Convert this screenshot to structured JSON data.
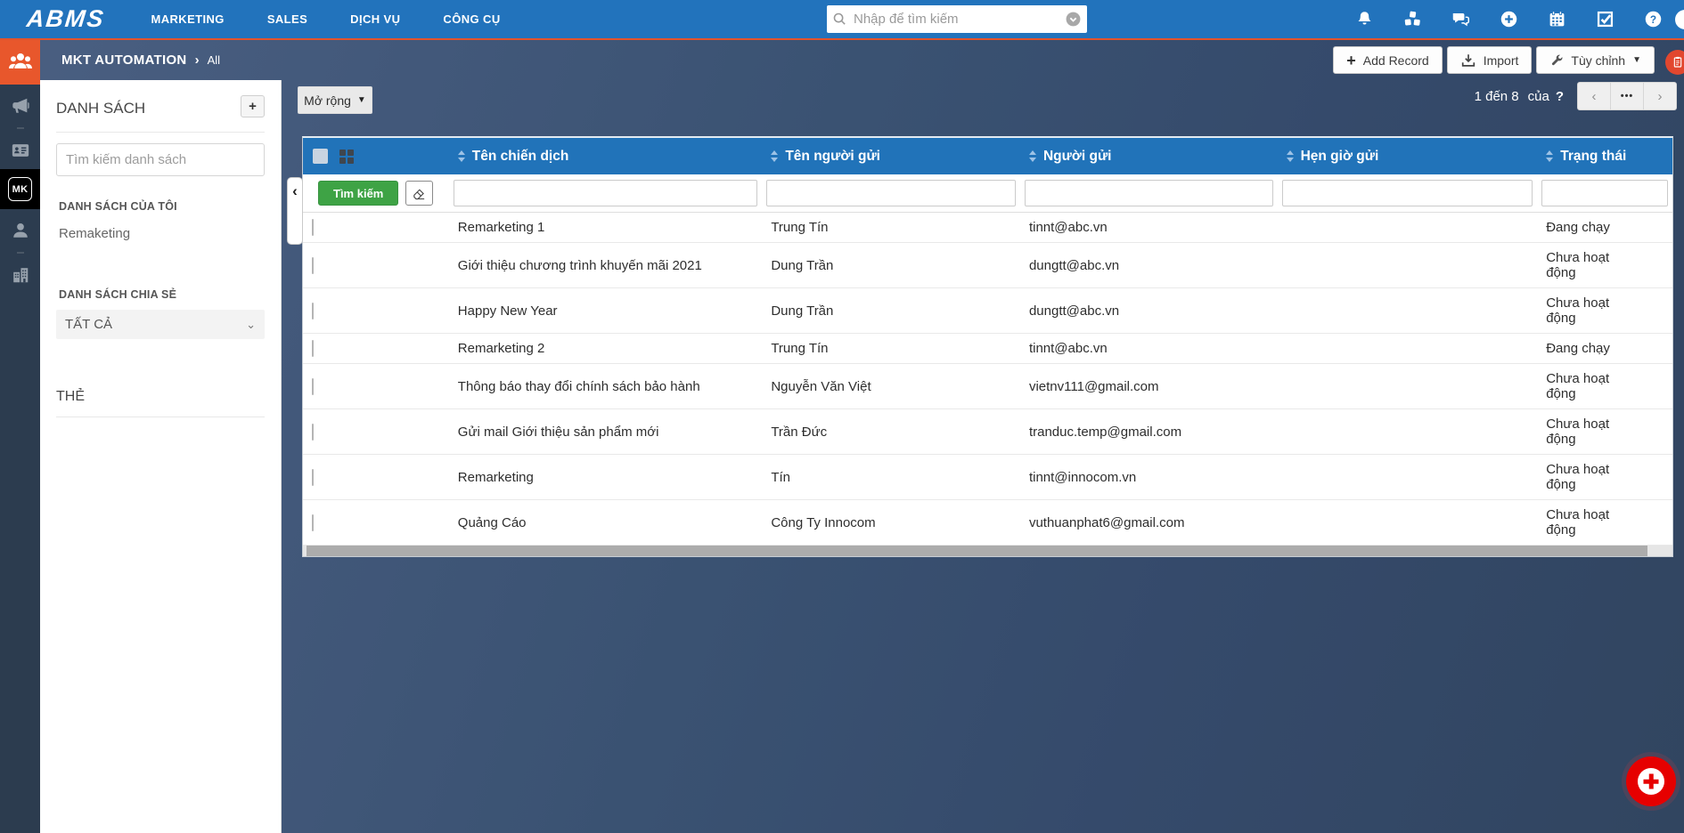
{
  "topbar": {
    "logo": "ABMS",
    "nav": [
      {
        "label": "MARKETING"
      },
      {
        "label": "SALES"
      },
      {
        "label": "DỊCH VỤ"
      },
      {
        "label": "CÔNG CỤ"
      }
    ],
    "search": {
      "placeholder": "Nhập để tìm kiếm",
      "value": ""
    },
    "icon_names": [
      "bell-icon",
      "cubes-icon",
      "chat-icon",
      "plus-circle-icon",
      "calendar-icon",
      "check-square-icon",
      "question-circle-icon"
    ]
  },
  "module_bar": {
    "title": "MKT AUTOMATION",
    "breadcrumb_separator": "›",
    "breadcrumb_current": "All",
    "add_record_label": "Add Record",
    "import_label": "Import",
    "customize_label": "Tùy chỉnh"
  },
  "sidebar": {
    "active_badge": "MK",
    "icon_names": [
      "people-group-icon",
      "megaphone-icon",
      "id-card-icon",
      "mk-module-icon",
      "person-icon",
      "building-icon"
    ]
  },
  "list_panel": {
    "title": "DANH SÁCH",
    "add_button": "+",
    "search_placeholder": "Tìm kiếm danh sách",
    "my_lists_label": "DANH SÁCH CỦA TÔI",
    "my_lists": [
      {
        "label": "Remaketing"
      }
    ],
    "shared_lists_label": "DANH SÁCH CHIA SẺ",
    "shared_filter_value": "TẤT CẢ",
    "tags_label": "THẺ"
  },
  "toolbar": {
    "expand_label": "Mở rộng"
  },
  "pagination": {
    "range_text": "1 đến 8",
    "of_label": "của",
    "total_label": "?",
    "ellipsis": "•••"
  },
  "table": {
    "search_button_label": "Tìm kiếm",
    "columns": [
      "Tên chiến dịch",
      "Tên người gửi",
      "Người gửi",
      "Hẹn giờ gửi",
      "Trạng thái"
    ],
    "rows": [
      {
        "campaign": "Remarketing 1",
        "sender_name": "Trung Tín",
        "sender_email": "tinnt@abc.vn",
        "schedule": "",
        "status": "Đang chạy"
      },
      {
        "campaign": "Giới thiệu chương trình khuyến mãi 2021",
        "sender_name": "Dung Trần",
        "sender_email": "dungtt@abc.vn",
        "schedule": "",
        "status": "Chưa hoạt động"
      },
      {
        "campaign": "Happy New Year",
        "sender_name": "Dung Trần",
        "sender_email": "dungtt@abc.vn",
        "schedule": "",
        "status": "Chưa hoạt động"
      },
      {
        "campaign": "Remarketing 2",
        "sender_name": "Trung Tín",
        "sender_email": "tinnt@abc.vn",
        "schedule": "",
        "status": "Đang chạy"
      },
      {
        "campaign": "Thông báo thay đổi chính sách bảo hành",
        "sender_name": "Nguyễn Văn Việt",
        "sender_email": "vietnv111@gmail.com",
        "schedule": "",
        "status": "Chưa hoạt động"
      },
      {
        "campaign": "Gửi mail Giới thiệu sản phẩm mới",
        "sender_name": "Trần Đức",
        "sender_email": "tranduc.temp@gmail.com",
        "schedule": "",
        "status": "Chưa hoạt động"
      },
      {
        "campaign": "Remarketing",
        "sender_name": "Tín",
        "sender_email": "tinnt@innocom.vn",
        "schedule": "",
        "status": "Chưa hoạt động"
      },
      {
        "campaign": "Quảng Cáo",
        "sender_name": "Công Ty Innocom",
        "sender_email": "vuthuanphat6@gmail.com",
        "schedule": "",
        "status": "Chưa hoạt động"
      }
    ]
  },
  "colors": {
    "topbar_blue": "#2273BC",
    "table_header_blue": "#2173B9",
    "slate_background": "#3A5272",
    "sidebar_dark": "#2C3C4F",
    "orange_accent": "#E8572C",
    "green_search": "#3EA345",
    "red_fab": "#E60000"
  }
}
